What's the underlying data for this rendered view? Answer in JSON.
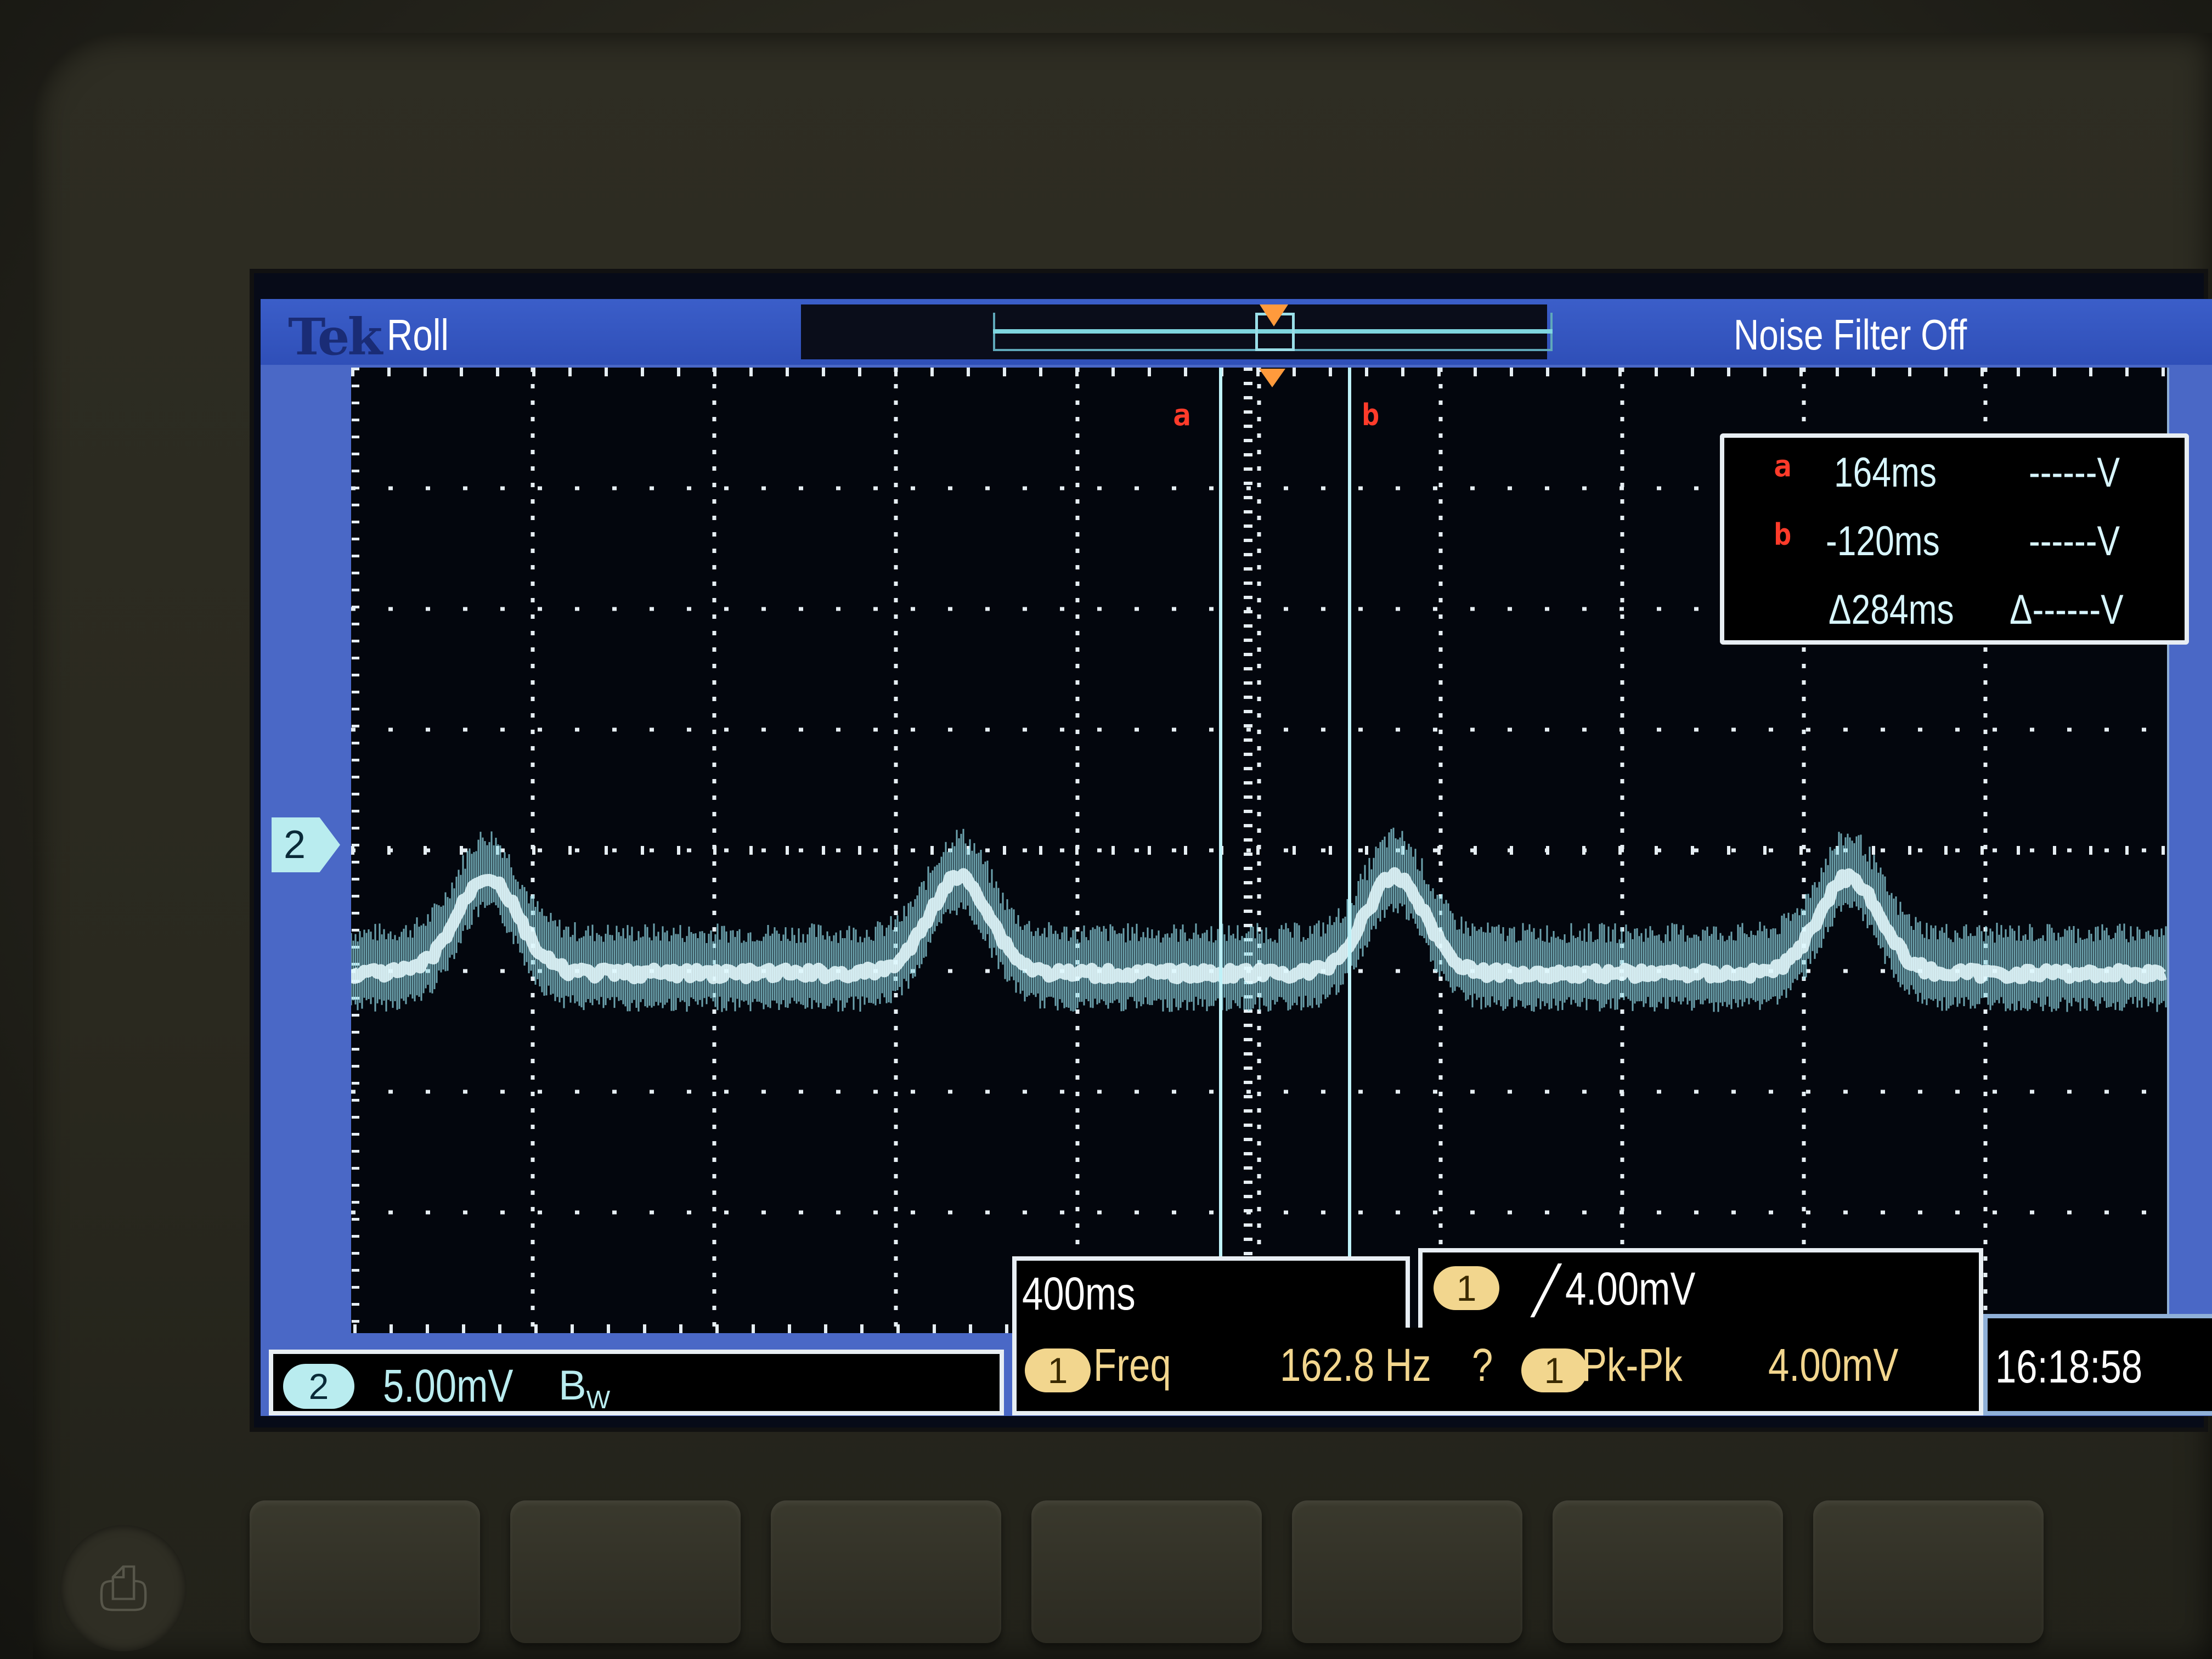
{
  "device": {
    "softkeys": [
      "",
      "",
      "",
      "",
      "",
      "",
      ""
    ]
  },
  "status_bar": {
    "logo": "Tek",
    "mode": "Roll",
    "noise_filter": "Noise Filter Off"
  },
  "channel_marker": {
    "label": "2"
  },
  "cursors": {
    "a_tag": "a",
    "b_tag": "b",
    "readout": [
      {
        "tag": "a",
        "time": "164ms",
        "volt": "------V"
      },
      {
        "tag": "b",
        "time": "-120ms",
        "volt": "------V"
      },
      {
        "tag": "",
        "time": "Δ284ms",
        "volt": "Δ------V"
      }
    ]
  },
  "timebase": {
    "value": "400ms"
  },
  "trigger": {
    "source": "1",
    "slope": "╱",
    "level": "4.00mV"
  },
  "channel2": {
    "badge": "2",
    "scale": "5.00mV",
    "bw_label": "B",
    "bw_sub": "W"
  },
  "measurements": [
    {
      "badge": "1",
      "name": "Freq",
      "value": "162.8 Hz",
      "flag": "?"
    },
    {
      "badge": "1",
      "name": "Pk-Pk",
      "value": "4.00mV",
      "flag": ""
    }
  ],
  "clock": "16:18:58",
  "colors": {
    "trace": "#8fd8e4",
    "trace_core": "#e8fbff",
    "cursor": "#ff3b2a",
    "trigger": "#ff9a3c",
    "frame": "#4a68c6",
    "measure": "#f2d68e"
  },
  "waveform": {
    "peak_times_div": [
      0.75,
      3.35,
      5.75,
      8.25
    ],
    "description_channel": "2"
  }
}
